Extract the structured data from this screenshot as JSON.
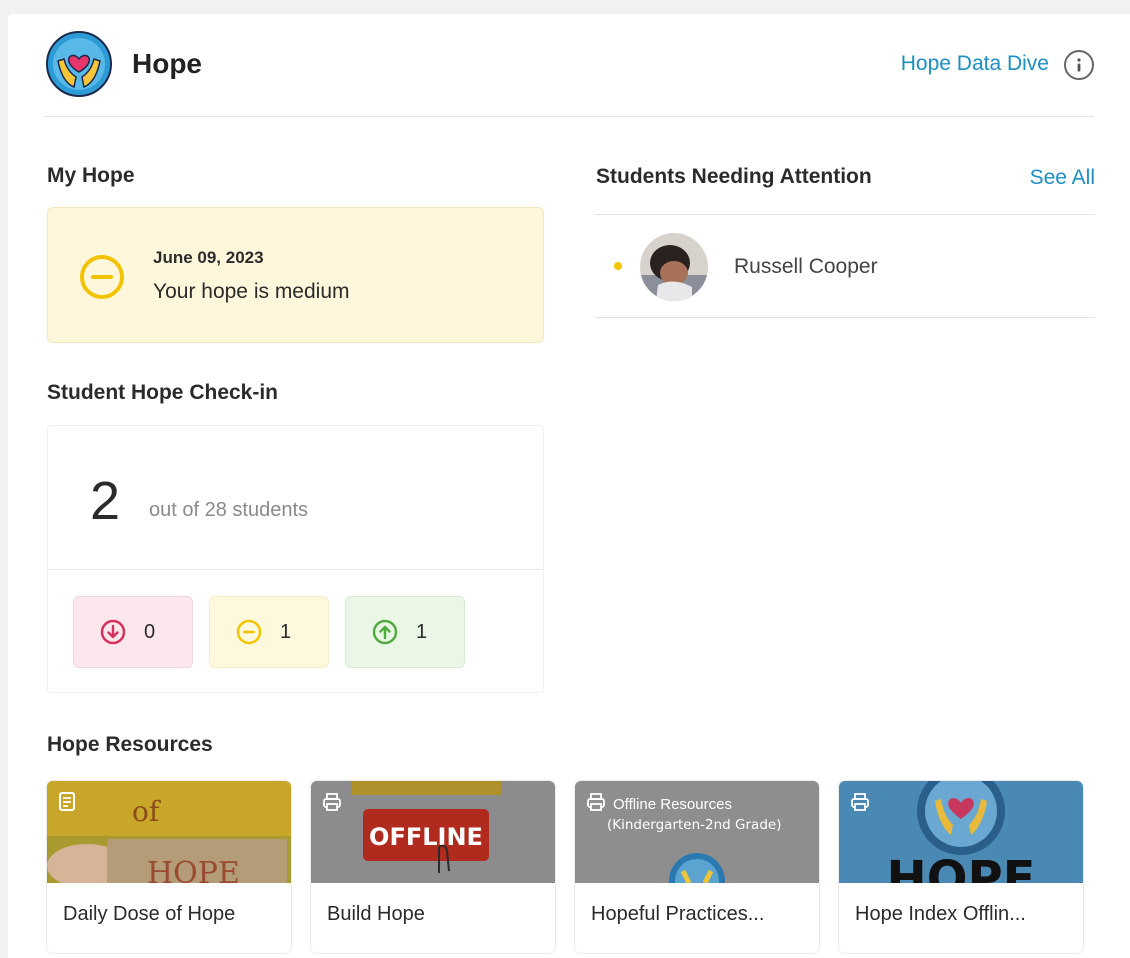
{
  "header": {
    "title": "Hope",
    "data_dive_link": "Hope Data Dive",
    "info_icon": "info-icon"
  },
  "my_hope": {
    "section_title": "My Hope",
    "date": "June 09, 2023",
    "status": "Your hope is medium",
    "icon": "medium-hope-icon"
  },
  "checkin": {
    "section_title": "Student Hope Check-in",
    "count": "2",
    "out_of": "out of 28 students",
    "breakdown": [
      {
        "level": "low",
        "icon": "arrow-down-circle-icon",
        "count": "0",
        "color": "#d62f5b"
      },
      {
        "level": "medium",
        "icon": "minus-circle-icon",
        "count": "1",
        "color": "#f2c300"
      },
      {
        "level": "high",
        "icon": "arrow-up-circle-icon",
        "count": "1",
        "color": "#4faa3f"
      }
    ]
  },
  "attention": {
    "section_title": "Students Needing Attention",
    "see_all": "See All",
    "students": [
      {
        "name": "Russell Cooper",
        "status_color": "#f3c400"
      }
    ]
  },
  "resources": {
    "section_title": "Hope Resources",
    "items": [
      {
        "label": "Daily Dose of Hope",
        "icon": "document-icon",
        "thumb_text": [
          "of",
          "HOPE"
        ]
      },
      {
        "label": "Build Hope",
        "icon": "printer-icon",
        "thumb_text": [
          "OFFLINE"
        ]
      },
      {
        "label": "Hopeful Practices...",
        "icon": "printer-icon",
        "thumb_text": [
          "Offline Resources",
          "(Kindergarten-2nd Grade)"
        ]
      },
      {
        "label": "Hope Index Offlin...",
        "icon": "printer-icon",
        "thumb_text": [
          "HOPE"
        ]
      }
    ]
  },
  "colors": {
    "accent": "#1c8fc0",
    "medium": "#f2c300",
    "low": "#d62f5b",
    "high": "#4faa3f"
  }
}
